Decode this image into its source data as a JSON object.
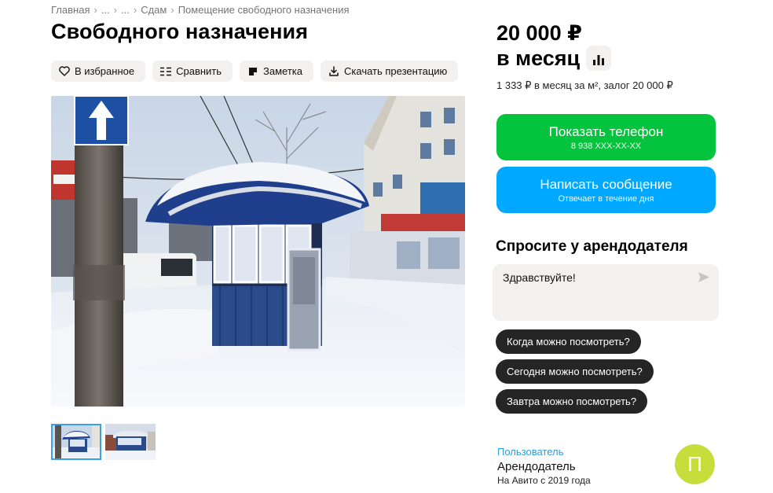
{
  "breadcrumb": {
    "items": [
      "Главная",
      "...",
      "...",
      "Сдам",
      "Помещение свободного назначения"
    ],
    "separator": "›"
  },
  "listing": {
    "title": "Свободного назначения"
  },
  "actions": {
    "favorite": {
      "label": "В избранное",
      "icon": "heart-icon"
    },
    "compare": {
      "label": "Сравнить",
      "icon": "compare-icon"
    },
    "note": {
      "label": "Заметка",
      "icon": "note-icon"
    },
    "download": {
      "label": "Скачать презентацию",
      "icon": "download-icon"
    }
  },
  "gallery": {
    "thumbnail_count": 2,
    "active_index": 0
  },
  "price": {
    "amount": "20 000 ₽",
    "period": "в месяц",
    "details": "1 333 ₽ в месяц за м², залог 20 000 ₽",
    "stats_icon": "bar-chart-icon"
  },
  "contact": {
    "phone_label": "Показать телефон",
    "phone_masked": "8 938 XXX-XX-XX",
    "message_label": "Написать сообщение",
    "message_sub": "Отвечает в течение дня"
  },
  "ask": {
    "title": "Спросите у арендодателя",
    "input_value": "Здравствуйте!",
    "send_icon": "send-icon",
    "quick_questions": [
      "Когда можно посмотреть?",
      "Сегодня можно посмотреть?",
      "Завтра можно посмотреть?"
    ]
  },
  "seller": {
    "type": "Пользователь",
    "name": "Арендодатель",
    "since": "На Авито с 2019 года",
    "avatar_letter": "П"
  },
  "colors": {
    "green": "#04c33c",
    "blue": "#00a8ff",
    "chip": "#252525",
    "avatar": "#c6de3c",
    "link": "#2a9fd8"
  }
}
